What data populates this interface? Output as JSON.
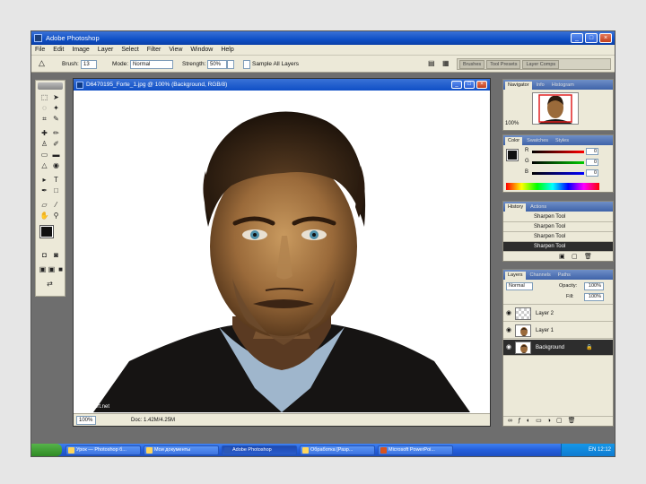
{
  "window": {
    "title": "Adobe Photoshop",
    "buttons": {
      "minimize": "_",
      "maximize": "□",
      "close": "×"
    }
  },
  "menu": [
    "File",
    "Edit",
    "Image",
    "Layer",
    "Select",
    "Filter",
    "View",
    "Window",
    "Help"
  ],
  "options": {
    "brush_label": "Brush:",
    "brush_value": "13",
    "mode_label": "Mode:",
    "mode_value": "Normal",
    "strength_label": "Strength:",
    "strength_value": "50%",
    "sample_all_label": "Sample All Layers",
    "wells": [
      "Brushes",
      "Tool Presets",
      "Layer Comps"
    ]
  },
  "document": {
    "title": "D6470195_Forte_1.jpg @ 100% (Background, RGB/8)",
    "zoom": "100%",
    "doc_size": "Doc: 1.42M/4.25M",
    "watermark": "bright-art.net"
  },
  "navigator": {
    "tabs": [
      "Navigator",
      "Info",
      "Histogram"
    ],
    "zoom": "100%"
  },
  "color": {
    "tabs": [
      "Color",
      "Swatches",
      "Styles"
    ],
    "r_label": "R",
    "g_label": "G",
    "b_label": "B",
    "r_value": "0",
    "g_value": "0",
    "b_value": "0"
  },
  "history": {
    "tabs": [
      "History",
      "Actions"
    ],
    "items": [
      "Sharpen Tool",
      "Sharpen Tool",
      "Sharpen Tool",
      "Sharpen Tool"
    ]
  },
  "layers": {
    "tabs": [
      "Layers",
      "Channels",
      "Paths"
    ],
    "mode": "Normal",
    "opacity_label": "Opacity:",
    "opacity": "100%",
    "fill_label": "Fill:",
    "fill": "100%",
    "items": [
      {
        "name": "Layer 2"
      },
      {
        "name": "Layer 1"
      },
      {
        "name": "Background"
      }
    ],
    "lock_glyph": "🔒"
  },
  "taskbar": {
    "items": [
      "Урок — Photoshop б...",
      "Мои документы",
      "Adobe Photoshop",
      "Обработка [Разр...",
      "Microsoft PowerPoi..."
    ],
    "tray": "EN",
    "clock": "12:12"
  },
  "colors": {
    "accent": "#0f4fc6",
    "panel_bg": "#ece9d8",
    "workspace": "#6e6e6e",
    "selected_row": "#2d2d2d"
  }
}
